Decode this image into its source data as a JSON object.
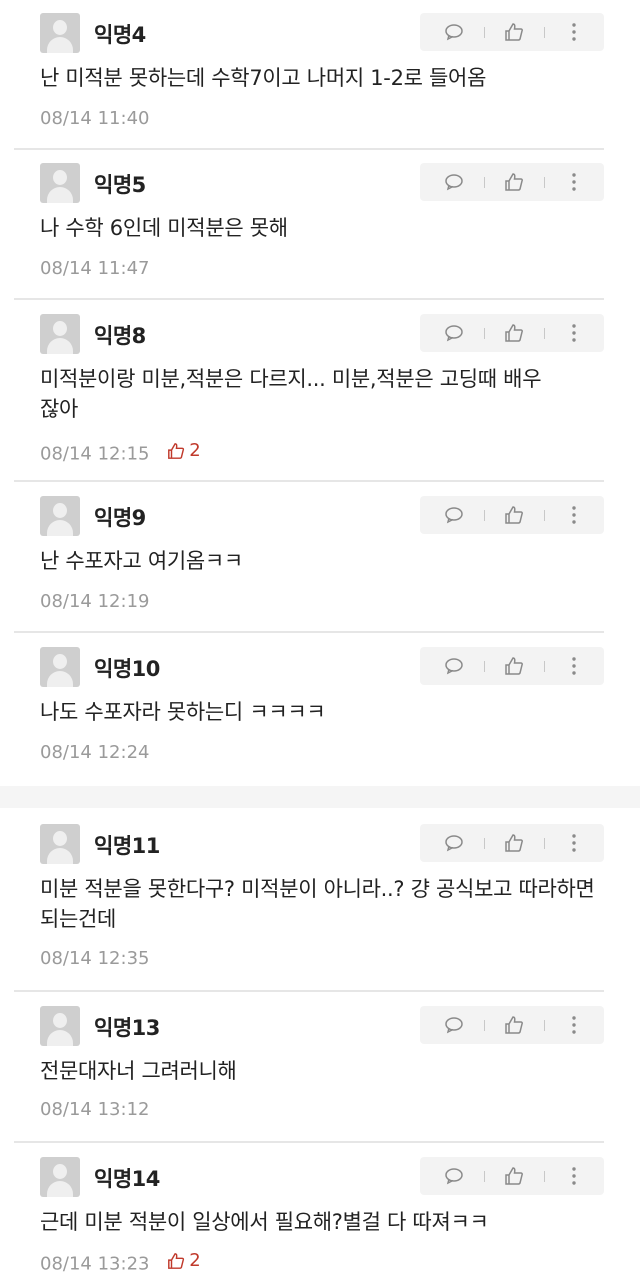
{
  "comments": [
    {
      "name": "익명4",
      "text": "난 미적분 못하는데 수학7이고 나머지 1-2로 들어옴",
      "time": "08/14 11:40",
      "likes": ""
    },
    {
      "name": "익명5",
      "text": "나 수학 6인데 미적분은 못해",
      "time": "08/14 11:47",
      "likes": ""
    },
    {
      "name": "익명8",
      "text": "미적분이랑 미분,적분은 다르지... 미분,적분은 고딩때 배우잖아",
      "time": "08/14 12:15",
      "likes": "2"
    },
    {
      "name": "익명9",
      "text": "난 수포자고 여기옴ㅋㅋ",
      "time": "08/14 12:19",
      "likes": ""
    },
    {
      "name": "익명10",
      "text": "나도 수포자라 못하는디 ㅋㅋㅋㅋ",
      "time": "08/14 12:24",
      "likes": ""
    },
    {
      "name": "익명11",
      "text": "미분 적분을 못한다구? 미적분이 아니라..? 걍 공식보고 따라하면 되는건데",
      "time": "08/14 12:35",
      "likes": ""
    },
    {
      "name": "익명13",
      "text": "전문대자너 그려러니해",
      "time": "08/14 13:12",
      "likes": ""
    },
    {
      "name": "익명14",
      "text": "근데 미분 적분이 일상에서 필요해?별걸 다 따져ㅋㅋ",
      "time": "08/14 13:23",
      "likes": "2"
    }
  ],
  "icons": {
    "reply": "speech-bubble-icon",
    "like": "thumbs-up-icon",
    "more": "more-vertical-icon"
  },
  "colors": {
    "like_accent": "#c0392b",
    "meta": "#9a9a9a",
    "action_bg": "#f3f3f3"
  }
}
